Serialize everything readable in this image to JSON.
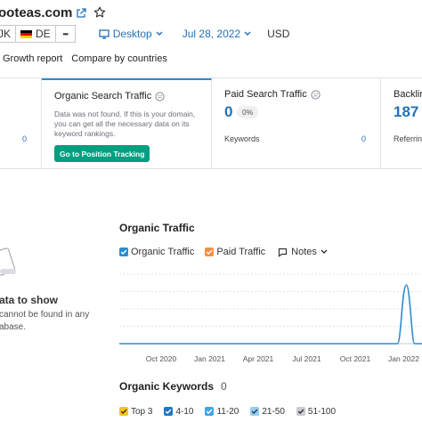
{
  "header": {
    "domain": "ooteas.com",
    "database_left": "JK",
    "database": "DE",
    "more": "•••",
    "device": "Desktop",
    "date": "Jul 28, 2022",
    "currency": "USD"
  },
  "tabs": [
    "Growth report",
    "Compare by countries"
  ],
  "cards": {
    "partial_left_value": "0",
    "organic": {
      "title": "Organic Search Traffic",
      "message": "Data was not found. If this is your domain, you can get all the necessary data on its keyword rankings.",
      "button": "Go to Position Tracking"
    },
    "paid": {
      "title": "Paid Search Traffic",
      "value": "0",
      "percent": "0%",
      "keywords_label": "Keywords",
      "keywords_value": "0"
    },
    "backlinks": {
      "title": "Backlinks",
      "value": "187",
      "referring_label": "Referring"
    }
  },
  "no_data": {
    "title": "ata to show",
    "text": "cannot be found in any abase."
  },
  "organic_traffic": {
    "title": "Organic Traffic",
    "legend": [
      {
        "label": "Organic Traffic",
        "color": "#2c8cd1"
      },
      {
        "label": "Paid Traffic",
        "color": "#ff8c42"
      }
    ],
    "notes": "Notes"
  },
  "chart_data": {
    "type": "line",
    "title": "Organic Traffic",
    "xlabel": "",
    "ylabel": "",
    "x": [
      "Oct 2020",
      "Jan 2021",
      "Apr 2021",
      "Jul 2021",
      "Oct 2021",
      "Jan 2022"
    ],
    "series": [
      {
        "name": "Organic Traffic",
        "color": "#2c8cd1",
        "values": [
          0,
          0,
          0,
          0,
          0,
          1
        ]
      },
      {
        "name": "Paid Traffic",
        "color": "#ff8c42",
        "values": [
          0,
          0,
          0,
          0,
          0,
          0
        ]
      }
    ],
    "grid": true,
    "legend": "top-left"
  },
  "organic_keywords": {
    "title": "Organic Keywords",
    "count": "0",
    "legend": [
      {
        "label": "Top 3",
        "color": "#f5c518"
      },
      {
        "label": "4-10",
        "color": "#1f78c9"
      },
      {
        "label": "11-20",
        "color": "#3fa6e8"
      },
      {
        "label": "21-50",
        "color": "#92cdf4"
      },
      {
        "label": "51-100",
        "color": "#c9cbd3"
      }
    ]
  }
}
